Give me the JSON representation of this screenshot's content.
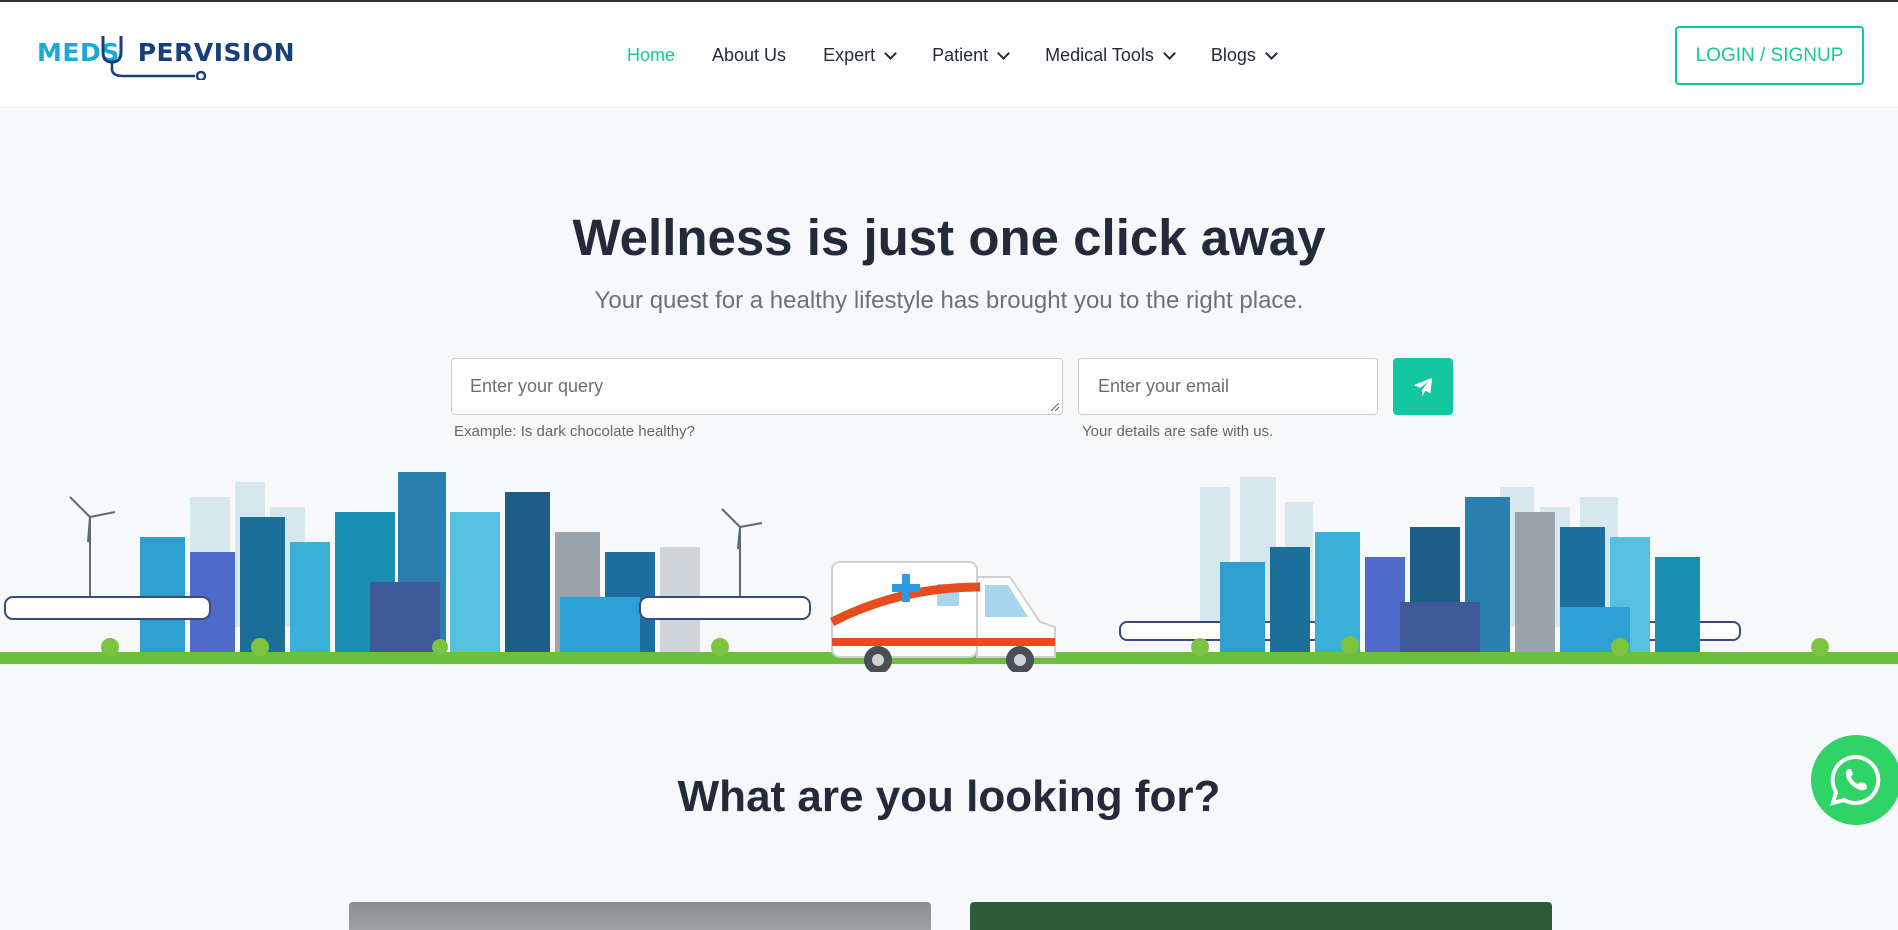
{
  "header": {
    "logo_text_a": "MEDS",
    "logo_text_b": "PERVISION",
    "nav": [
      {
        "label": "Home",
        "active": true,
        "dropdown": false
      },
      {
        "label": "About Us",
        "active": false,
        "dropdown": false
      },
      {
        "label": "Expert",
        "active": false,
        "dropdown": true
      },
      {
        "label": "Patient",
        "active": false,
        "dropdown": true
      },
      {
        "label": "Medical Tools",
        "active": false,
        "dropdown": true
      },
      {
        "label": "Blogs",
        "active": false,
        "dropdown": true
      }
    ],
    "login_label": "LOGIN / SIGNUP"
  },
  "hero": {
    "title": "Wellness is just one click away",
    "subtitle": "Your quest for a healthy lifestyle has brought you to the right place.",
    "query_placeholder": "Enter your query",
    "email_placeholder": "Enter your email",
    "query_hint": "Example: Is dark chocolate healthy?",
    "email_hint": "Your details are safe with us.",
    "send_icon": "paper-plane-icon"
  },
  "section": {
    "title": "What are you looking for?"
  },
  "whatsapp_icon": "whatsapp-icon",
  "colors": {
    "accent": "#13c7a0",
    "heading": "#232a3b",
    "logo_blue": "#1aa9df",
    "whatsapp_green": "#2fd366"
  }
}
